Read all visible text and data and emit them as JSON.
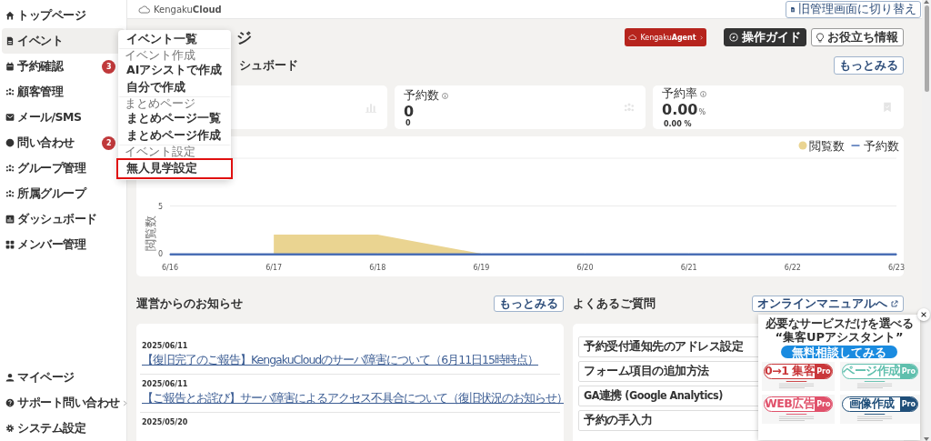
{
  "sidebar": {
    "items": [
      {
        "label": "トップページ",
        "selected": false,
        "expandable": false
      },
      {
        "label": "イベント",
        "selected": true,
        "expandable": true
      },
      {
        "label": "予約確認",
        "selected": false,
        "expandable": true,
        "badge": "3"
      },
      {
        "label": "顧客管理",
        "selected": false,
        "expandable": true
      },
      {
        "label": "メール/SMS",
        "selected": false,
        "expandable": true
      },
      {
        "label": "問い合わせ",
        "selected": false,
        "expandable": true,
        "badge": "2"
      },
      {
        "label": "グループ管理",
        "selected": false,
        "expandable": true
      },
      {
        "label": "所属グループ",
        "selected": false,
        "expandable": false
      },
      {
        "label": "ダッシュボード",
        "selected": false,
        "expandable": false
      },
      {
        "label": "メンバー管理",
        "selected": false,
        "expandable": false
      }
    ],
    "footer_items": [
      {
        "label": "マイページ",
        "selected": false,
        "expandable": false
      },
      {
        "label": "サポート問い合わせ",
        "selected": false,
        "expandable": true
      },
      {
        "label": "システム設定",
        "selected": false,
        "expandable": false
      }
    ]
  },
  "header": {
    "logo": "Kengaku**Cloud**",
    "switch_button": "旧管理画面に切り替え"
  },
  "page": {
    "title": "ジ",
    "agent_button": "Kengaku**Agent**",
    "guide_button": "操作ガイド",
    "info_button": "お役立ち情報"
  },
  "dashboard": {
    "heading": "シュボード",
    "more_button": "もっとみる",
    "stats": [
      {
        "kind": "blank"
      },
      {
        "kind": "metric",
        "label": "予約数",
        "value": "0",
        "sub_value": "0"
      },
      {
        "kind": "metric",
        "label": "予約率",
        "value": "0.00",
        "unit": "%",
        "sub_value": "0.00 %"
      }
    ],
    "chart": {
      "chart_data": {
        "type": "area",
        "ylabel": "閲覧数",
        "categories": [
          "6/16",
          "6/17",
          "6/18",
          "6/19",
          "6/20",
          "6/21",
          "6/22",
          "6/23"
        ],
        "ylim": [
          0,
          10
        ],
        "yticks": [
          0,
          5
        ],
        "legend": "top-right",
        "series": [
          {
            "name": "閲覧数",
            "color": "#ead491",
            "values": [
              null,
              2,
              2,
              0,
              0,
              0,
              0,
              0
            ]
          },
          {
            "name": "予約数",
            "color": "#4a6fb5",
            "values": [
              0,
              0,
              0,
              0,
              0,
              0,
              0,
              0
            ]
          }
        ]
      }
    }
  },
  "notices": {
    "heading": "運営からのお知らせ",
    "more_button": "もっとみる",
    "items": [
      {
        "date": "2025/06/11",
        "title": "【復旧完了のご報告】KengakuCloudのサーバ障害について（6月11日15時時点）"
      },
      {
        "date": "2025/06/11",
        "title": "【ご報告とお詫び】サーバ障害によるアクセス不具合について（復旧状況のお知らせ）"
      },
      {
        "date": "2025/05/20"
      }
    ]
  },
  "faq": {
    "heading": "よくあるご質問",
    "manual_button": "オンラインマニュアルへ",
    "items": [
      "予約受付通知先のアドレス設定",
      "フォーム項目の追加方法",
      "GA連携 (Google Analytics)",
      "予約の手入力"
    ]
  },
  "dropdown": {
    "items": [
      {
        "kind": "item",
        "label": "イベント一覧",
        "highlighted": false
      },
      {
        "kind": "header",
        "label": "イベント作成",
        "highlighted": false
      },
      {
        "kind": "item",
        "label": "AIアシストで作成",
        "highlighted": false
      },
      {
        "kind": "item",
        "label": "自分で作成",
        "highlighted": false
      },
      {
        "kind": "header",
        "label": "まとめページ",
        "highlighted": false
      },
      {
        "kind": "item",
        "label": "まとめページ一覧",
        "highlighted": false
      },
      {
        "kind": "item",
        "label": "まとめページ作成",
        "highlighted": false
      },
      {
        "kind": "header",
        "label": "イベント設定",
        "highlighted": false
      },
      {
        "kind": "item",
        "label": "無人見学設定",
        "highlighted": true
      }
    ]
  },
  "promo": {
    "subtitle": "必要なサービスだけを選べる",
    "title": "“集客UPアシスタント”",
    "cta": "無料相談してみる",
    "tiles": [
      {
        "label": "0→1 集客",
        "tag": "Pro",
        "color": "#c9373a"
      },
      {
        "label": "ページ作成",
        "tag": "Pro",
        "color": "#5fbfad"
      },
      {
        "label": "WEB広告",
        "tag": "Pro",
        "color": "#e0506a"
      },
      {
        "label": "画像作成",
        "tag": "Pro",
        "color": "#1f4e79"
      }
    ]
  }
}
